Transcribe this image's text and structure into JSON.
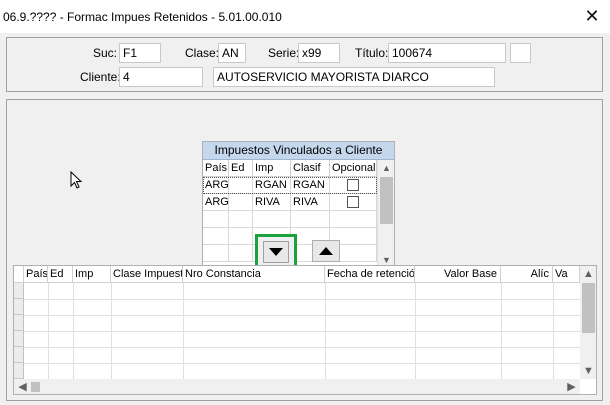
{
  "window": {
    "title": "06.9.???? - Formac Impues Retenidos - 5.01.00.010",
    "close_glyph": "✕"
  },
  "header": {
    "suc": {
      "label": "Suc:",
      "value": "F1"
    },
    "clase": {
      "label": "Clase:",
      "value": "AN"
    },
    "serie": {
      "label": "Serie:",
      "value": "x99"
    },
    "titulo": {
      "label": "Título:",
      "value": "100674"
    },
    "cliente": {
      "label": "Cliente:",
      "code": "4",
      "name": "AUTOSERVICIO MAYORISTA DIARCO"
    }
  },
  "linked_taxes": {
    "title": "Impuestos Vinculados a Cliente",
    "columns": [
      "País",
      "Ed",
      "Imp",
      "Clasif",
      "Opcional"
    ],
    "rows": [
      {
        "pais": "ARG",
        "ed": "",
        "imp": "RGAN",
        "clasif": "RGAN",
        "opcional": false
      },
      {
        "pais": "ARG",
        "ed": "",
        "imp": "RIVA",
        "clasif": "RIVA",
        "opcional": false
      }
    ]
  },
  "actions": {
    "move_down_icon": "triangle-down-icon",
    "move_up_icon": "triangle-up-icon"
  },
  "retained_grid": {
    "columns": [
      "País",
      "Ed",
      "Imp",
      "Clase Impuest",
      "Nro Constancia",
      "Fecha de retenciór",
      "Valor Base",
      "Alíc",
      "Va"
    ]
  },
  "colors": {
    "highlight_border": "#1aa33c",
    "grid_title_bg": "#c5d7ec",
    "panel_bg": "#f0f0f0"
  }
}
